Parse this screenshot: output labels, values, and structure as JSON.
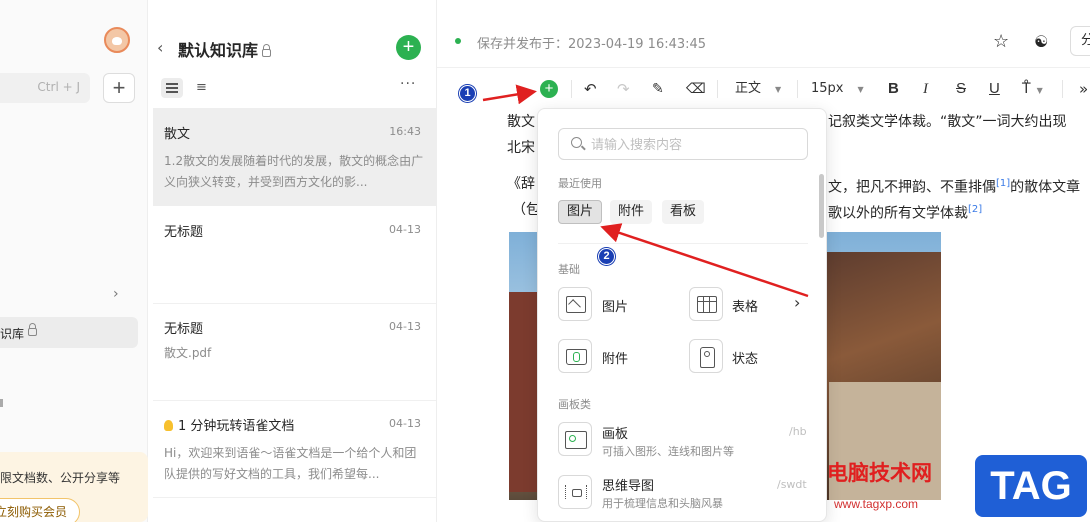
{
  "sidebar": {
    "search_shortcut": "Ctrl + J",
    "plus_label": "+",
    "kb_item_label": "识库",
    "promo_text": "限文档数、公开分享等",
    "promo_button": "立刻购买会员"
  },
  "doclist": {
    "title": "默认知识库",
    "new_doc_label": "+",
    "more_label": "···",
    "items": [
      {
        "title": "散文",
        "date": "16:43",
        "summary": "1.2散文的发展随着时代的发展，散文的概念由广义向狭义转变，并受到西方文化的影..."
      },
      {
        "title": "无标题",
        "date": "04-13",
        "summary": ""
      },
      {
        "title": "无标题",
        "date": "04-13",
        "summary": "散文.pdf"
      },
      {
        "title": "1 分钟玩转语雀文档",
        "date": "04-13",
        "summary": "Hi，欢迎来到语雀～语雀文档是一个给个人和团队提供的写好文档的工具，我们希望每..."
      }
    ]
  },
  "header": {
    "status": "保存并发布于：2023-04-19 16:43:45",
    "share_label": "分"
  },
  "toolbar": {
    "paragraph": "正文",
    "font_size": "15px",
    "bold": "B",
    "italic": "I",
    "strike": "S",
    "underline": "U"
  },
  "content": {
    "line1_a": "散文",
    "line1_b": "记叙类文学体裁。“散文”一词大约出现",
    "line2": "北宋",
    "line3_a": "《辞",
    "line3_b": "文，把凡不押韵、不重排偶",
    "line3_ref": "[1]",
    "line3_c": "的散体文章",
    "line4_a": "（包",
    "line4_b": "歌以外的所有文学体裁",
    "line4_ref": "[2]"
  },
  "popup": {
    "search_placeholder": "请输入搜索内容",
    "recent_label": "最近使用",
    "recent": [
      "图片",
      "附件",
      "看板"
    ],
    "basic_label": "基础",
    "basic": [
      {
        "label": "图片",
        "icon": "image-icon"
      },
      {
        "label": "表格",
        "icon": "table-icon"
      },
      {
        "label": "附件",
        "icon": "attachment-icon"
      },
      {
        "label": "状态",
        "icon": "status-tag-icon"
      }
    ],
    "board_label": "画板类",
    "boards": [
      {
        "label": "画板",
        "desc": "可插入图形、连线和图片等",
        "shortcut": "/hb",
        "icon": "drawing-board-icon"
      },
      {
        "label": "思维导图",
        "desc": "用于梳理信息和头脑风暴",
        "shortcut": "/swdt",
        "icon": "mind-map-icon"
      }
    ]
  },
  "annotations": {
    "badge1": "1",
    "badge2": "2",
    "arrow_color": "#e02020"
  },
  "watermark": {
    "site_name": "电脑技术网",
    "url": "www.tagxp.com",
    "tag": "TAG"
  },
  "colors": {
    "brand_green": "#2cb151",
    "link_blue": "#3b7be6"
  }
}
